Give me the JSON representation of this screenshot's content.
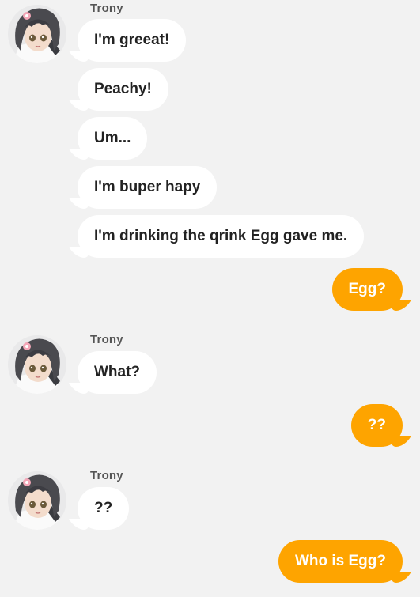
{
  "theme": {
    "background": "#f2f2f2",
    "incoming_bubble": "#ffffff",
    "outgoing_bubble": "#fea400",
    "sender_color": "#555555"
  },
  "messages": {
    "group1": {
      "sender": "Trony",
      "avatar_icon": "character-avatar-icon",
      "lines": [
        "I'm greeat!",
        "Peachy!",
        "Um...",
        "I'm buper hapy",
        "I'm drinking the qrink Egg gave me."
      ]
    },
    "out1": "Egg?",
    "group2": {
      "sender": "Trony",
      "avatar_icon": "character-avatar-icon",
      "lines": [
        "What?"
      ]
    },
    "out2": "??",
    "group3": {
      "sender": "Trony",
      "avatar_icon": "character-avatar-icon",
      "lines": [
        "??"
      ]
    },
    "out3": "Who is Egg?"
  }
}
